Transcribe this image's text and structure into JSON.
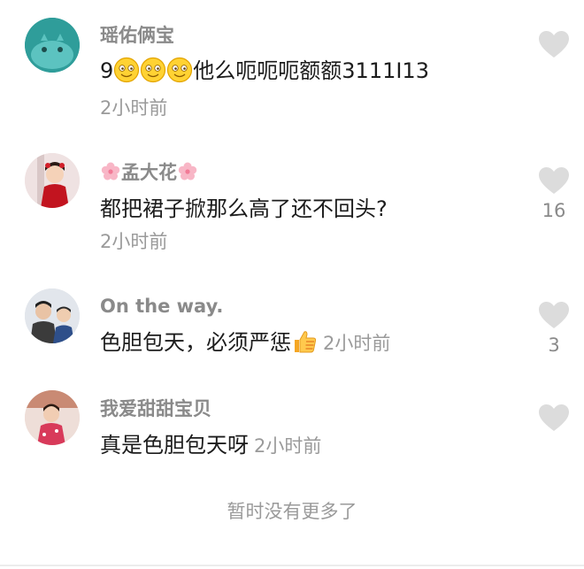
{
  "comments": [
    {
      "username": "瑶佑俩宝",
      "text_lead": "9",
      "text_tail": "他么呃呃呃额额3111I13",
      "emoji_name": "smiling-face-emoji",
      "time": "2小时前",
      "likes": ""
    },
    {
      "username": "孟大花",
      "username_decoration": "cherry-blossom-icon",
      "text": "都把裙子掀那么高了还不回头?",
      "time": "2小时前",
      "likes": "16"
    },
    {
      "username": "On the way.",
      "text": "色胆包天，必须严惩",
      "emoji_name": "thumbs-up-emoji",
      "time": "2小时前",
      "likes": "3"
    },
    {
      "username": "我爱甜甜宝贝",
      "text": "真是色胆包天呀",
      "time": "2小时前",
      "likes": ""
    }
  ],
  "footer": {
    "end_text": "暂时没有更多了"
  },
  "colors": {
    "username": "#8a8a8a",
    "content": "#1c1c1c",
    "meta": "#9a9a9a",
    "heart": "#dcdcdc",
    "avatar_1": "#2f9d9a"
  },
  "icons": [
    "heart-icon",
    "smiling-face-emoji",
    "thumbs-up-emoji",
    "cherry-blossom-icon"
  ]
}
